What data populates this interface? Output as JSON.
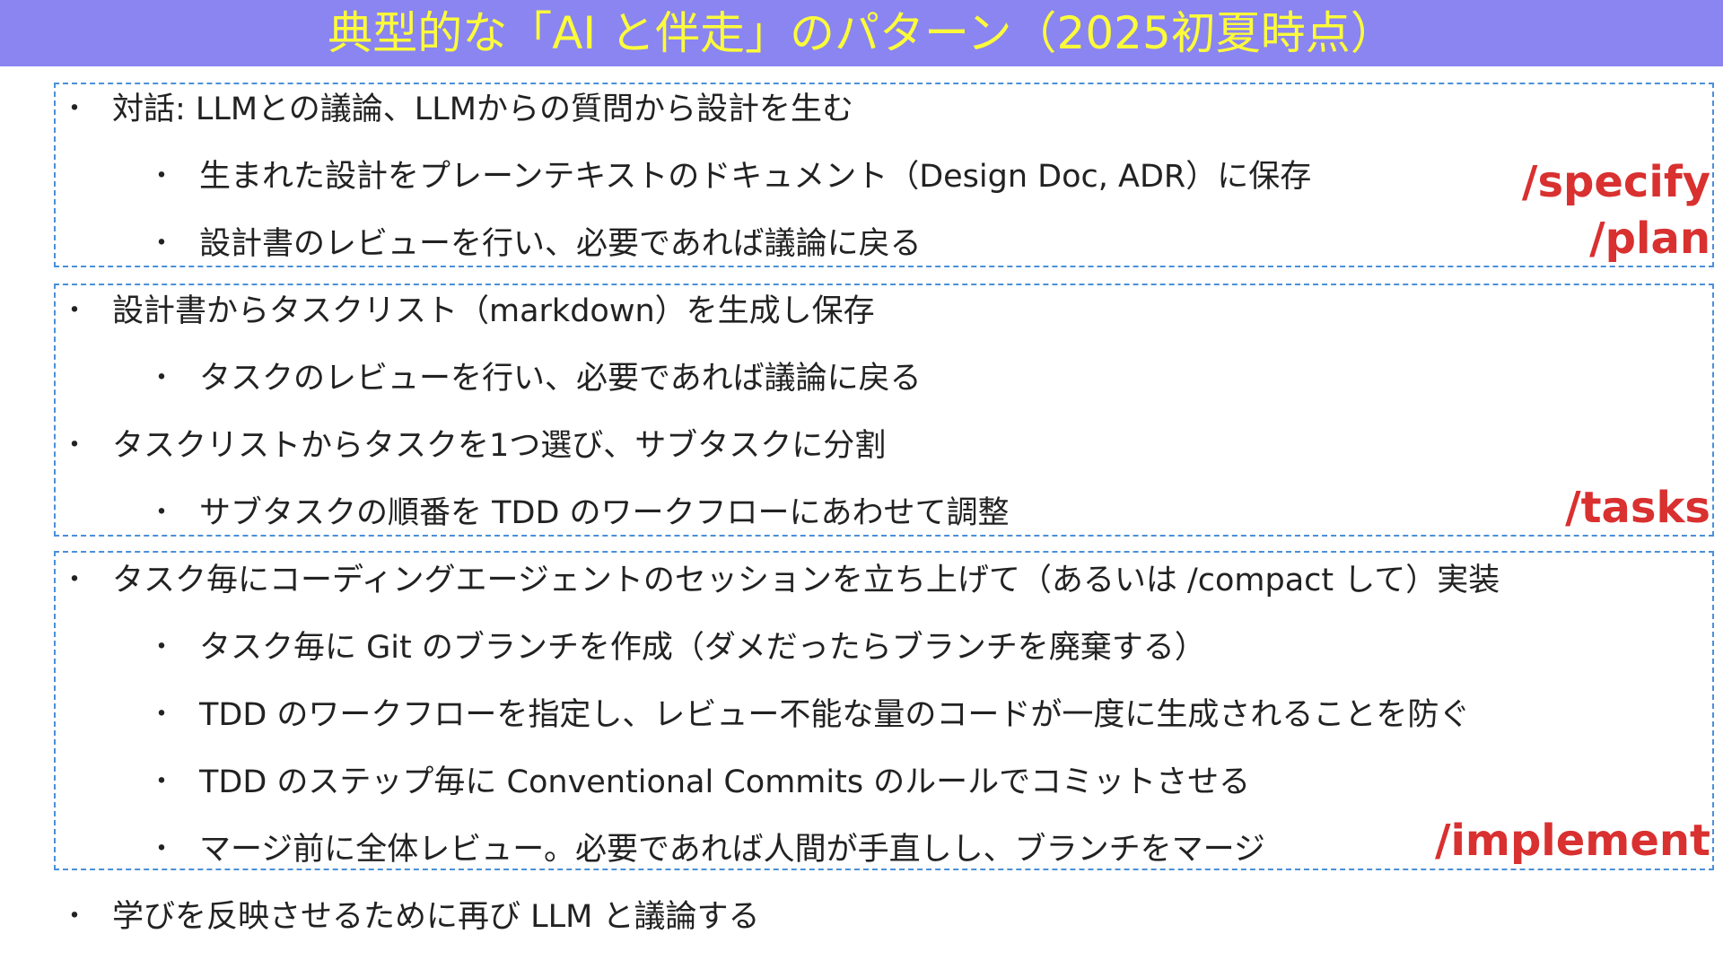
{
  "title": "典型的な「AI と伴走」のパターン（2025初夏時点）",
  "bullet_symbol": "・",
  "groups": [
    {
      "command": "/specify",
      "command2": "/plan",
      "items": [
        {
          "level": 1,
          "text": "対話: LLMとの議論、LLMからの質問から設計を生む"
        },
        {
          "level": 2,
          "text": "生まれた設計をプレーンテキストのドキュメント（Design Doc, ADR）に保存"
        },
        {
          "level": 2,
          "text": "設計書のレビューを行い、必要であれば議論に戻る"
        }
      ]
    },
    {
      "command": "/tasks",
      "items": [
        {
          "level": 1,
          "text": "設計書からタスクリスト（markdown）を生成し保存"
        },
        {
          "level": 2,
          "text": "タスクのレビューを行い、必要であれば議論に戻る"
        },
        {
          "level": 1,
          "text": "タスクリストからタスクを1つ選び、サブタスクに分割"
        },
        {
          "level": 2,
          "text": "サブタスクの順番を TDD のワークフローにあわせて調整"
        }
      ]
    },
    {
      "command": "/implement",
      "items": [
        {
          "level": 1,
          "text": "タスク毎にコーディングエージェントのセッションを立ち上げて（あるいは /compact して）実装"
        },
        {
          "level": 2,
          "text": "タスク毎に Git のブランチを作成（ダメだったらブランチを廃棄する）"
        },
        {
          "level": 2,
          "text": "TDD のワークフローを指定し、レビュー不能な量のコードが一度に生成されることを防ぐ"
        },
        {
          "level": 2,
          "text": "TDD のステップ毎に Conventional Commits のルールでコミットさせる"
        },
        {
          "level": 2,
          "text": "マージ前に全体レビュー。必要であれば人間が手直しし、ブランチをマージ"
        }
      ]
    }
  ],
  "final_item": {
    "level": 1,
    "text": "学びを反映させるために再び LLM と議論する"
  },
  "colors": {
    "title_bar": "#8a85f0",
    "title_text": "#fcfb3a",
    "group_border": "#4a90d9",
    "command_text": "#d93030"
  }
}
